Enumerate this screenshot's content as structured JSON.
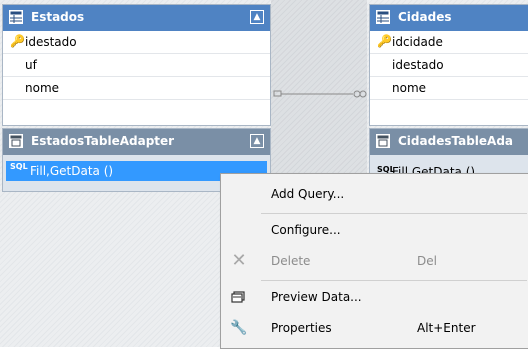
{
  "estados": {
    "title": "Estados",
    "columns": [
      {
        "name": "idestado",
        "key": true
      },
      {
        "name": "uf",
        "key": false
      },
      {
        "name": "nome",
        "key": false
      }
    ],
    "adapter_title": "EstadosTableAdapter",
    "query": "Fill,GetData ()",
    "sql_icon": "SQL"
  },
  "cidades": {
    "title": "Cidades",
    "columns": [
      {
        "name": "idcidade",
        "key": true
      },
      {
        "name": "idestado",
        "key": false
      },
      {
        "name": "nome",
        "key": false
      }
    ],
    "adapter_title": "CidadesTableAda",
    "query": "Fill,GetData ()",
    "sql_icon": "SQL"
  },
  "context_menu": {
    "items": [
      {
        "label": "Add Query...",
        "icon": "",
        "shortcut": "",
        "disabled": false
      },
      {
        "label": "Configure...",
        "icon": "",
        "shortcut": "",
        "disabled": false
      },
      {
        "label": "Delete",
        "icon": "delete-x-icon",
        "shortcut": "Del",
        "disabled": true
      },
      {
        "label": "Preview Data...",
        "icon": "preview-data-icon",
        "shortcut": "",
        "disabled": false
      },
      {
        "label": "Properties",
        "icon": "wrench-icon",
        "shortcut": "Alt+Enter",
        "disabled": false
      }
    ]
  },
  "colors": {
    "header_blue": "#4f83c3",
    "adapter_header": "#7a8fa6",
    "selection": "#3399ff",
    "menu_bg": "#f2f2f2"
  }
}
